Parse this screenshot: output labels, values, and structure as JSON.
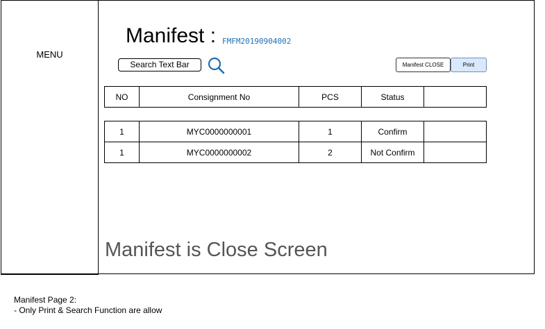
{
  "sidebar": {
    "menu_label": "MENU"
  },
  "header": {
    "title": "Manifest :",
    "manifest_id": "FMFM20190904002"
  },
  "search": {
    "label": "Search Text Bar",
    "icon": "search-icon"
  },
  "actions": {
    "close_label": "Manifest CLOSE",
    "print_label": "Print"
  },
  "table": {
    "columns": [
      "NO",
      "Consignment No",
      "PCS",
      "Status",
      ""
    ],
    "rows": [
      {
        "no": "1",
        "consignment": "MYC0000000001",
        "pcs": "1",
        "status": "Confirm",
        "extra": ""
      },
      {
        "no": "1",
        "consignment": "MYC0000000002",
        "pcs": "2",
        "status": "Not Confirm",
        "extra": ""
      }
    ]
  },
  "caption": "Manifest is Close Screen",
  "notes": {
    "line1": "Manifest Page 2:",
    "line2": "- Only Print & Search Function are allow"
  },
  "colors": {
    "accent": "#1f6fb5",
    "print_bg": "#dae8fc",
    "print_border": "#6c8ebf",
    "caption": "#555555"
  }
}
